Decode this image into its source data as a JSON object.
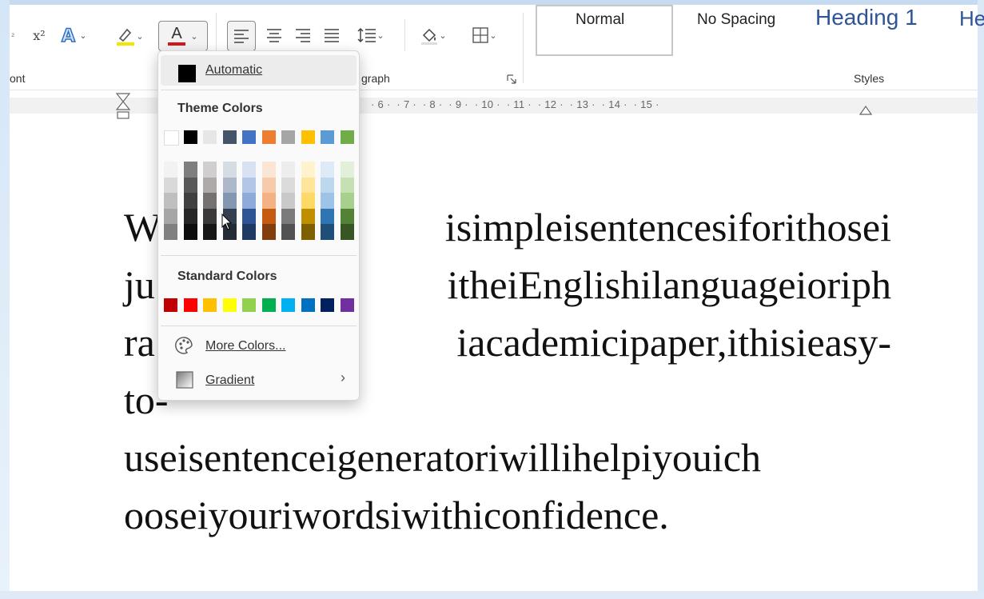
{
  "ribbon": {
    "font_group_label": "ont",
    "paragraph_group_label": "graph",
    "styles_group_label": "Styles",
    "styles": [
      "Normal",
      "No Spacing",
      "Heading 1",
      "He"
    ],
    "superscript_label": "x²",
    "font_color_letter": "A",
    "font_color_accent": "#d11a1a",
    "highlight_accent": "#f2e600"
  },
  "ruler": {
    "numbers": "· 6 ·  · 7 ·  · 8 ·  · 9 ·  · 10 ·  · 11 ·  · 12 ·  · 13 ·  · 14 ·  · 15 ·"
  },
  "font_color_menu": {
    "automatic_label": "Automatic",
    "theme_heading": "Theme Colors",
    "standard_heading": "Standard Colors",
    "more_colors_label": "More Colors...",
    "gradient_label": "Gradient",
    "theme_colors": [
      "#ffffff",
      "#000000",
      "#e7e6e6",
      "#44546a",
      "#4472c4",
      "#ed7d31",
      "#a5a5a5",
      "#ffc000",
      "#5b9bd5",
      "#70ad47"
    ],
    "theme_shades": [
      [
        "#f2f2f2",
        "#d9d9d9",
        "#bfbfbf",
        "#a6a6a6",
        "#808080"
      ],
      [
        "#7f7f7f",
        "#595959",
        "#404040",
        "#262626",
        "#0d0d0d"
      ],
      [
        "#d0cece",
        "#aeaaaa",
        "#757171",
        "#3a3838",
        "#171616"
      ],
      [
        "#d6dce4",
        "#adb9ca",
        "#8497b0",
        "#333f4f",
        "#222a35"
      ],
      [
        "#d9e2f3",
        "#b4c6e7",
        "#8eaadb",
        "#2f5496",
        "#1f3864"
      ],
      [
        "#fbe5d5",
        "#f7caac",
        "#f4b183",
        "#c55a11",
        "#833c0b"
      ],
      [
        "#ededed",
        "#dbdbdb",
        "#c9c9c9",
        "#7b7b7b",
        "#525252"
      ],
      [
        "#fff2cc",
        "#ffe599",
        "#ffd966",
        "#bf8f00",
        "#7f6000"
      ],
      [
        "#deebf6",
        "#bdd7ee",
        "#9dc3e6",
        "#2e75b5",
        "#1f4e79"
      ],
      [
        "#e2efd9",
        "#c5e0b3",
        "#a8d08d",
        "#538135",
        "#375623"
      ]
    ],
    "standard_colors": [
      "#c00000",
      "#ff0000",
      "#ffc000",
      "#ffff00",
      "#92d050",
      "#00b050",
      "#00b0f0",
      "#0070c0",
      "#002060",
      "#7030a0"
    ]
  },
  "document": {
    "text": "Whisimpleisentencesiforithoseijuitheienglishilanguageioriphraiacademicipaper,ithisieasy-to-useisentenceigeneratoriwillihelpiyouichooseiyouriwordsiwithiconfidence.",
    "lines": [
      "W",
      "ju",
      "ra",
      "to-",
      "useisentenceigeneratoriwillihelpiyouich",
      "ooseiyouriwordsiwithiconfidence."
    ],
    "visible_right_parts": [
      "isimpleisentencesiforithosei",
      "itheiEnglishilanguageioriph",
      "iacademicipaper,ithisieasy-"
    ]
  }
}
